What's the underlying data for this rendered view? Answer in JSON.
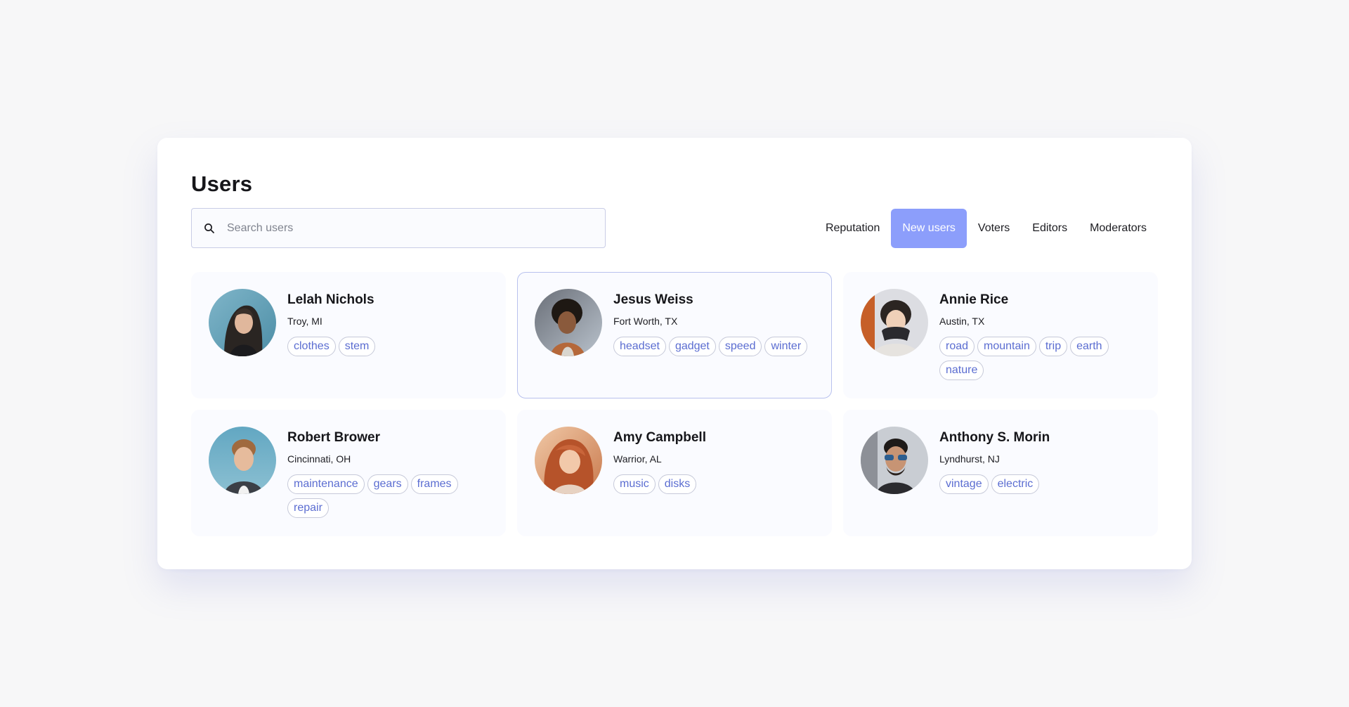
{
  "page": {
    "title": "Users"
  },
  "search": {
    "placeholder": "Search users",
    "value": ""
  },
  "tabs": [
    {
      "label": "Reputation",
      "active": false
    },
    {
      "label": "New users",
      "active": true
    },
    {
      "label": "Voters",
      "active": false
    },
    {
      "label": "Editors",
      "active": false
    },
    {
      "label": "Moderators",
      "active": false
    }
  ],
  "colors": {
    "accent": "#8c9efb",
    "tag_text": "#5b6dd1"
  },
  "users": [
    {
      "name": "Lelah Nichols",
      "location": "Troy, MI",
      "tags": [
        "clothes",
        "stem"
      ],
      "avatar_icon": "avatar-photo"
    },
    {
      "name": "Jesus Weiss",
      "location": "Fort Worth, TX",
      "tags": [
        "headset",
        "gadget",
        "speed",
        "winter"
      ],
      "avatar_icon": "avatar-photo"
    },
    {
      "name": "Annie Rice",
      "location": "Austin, TX",
      "tags": [
        "road",
        "mountain",
        "trip",
        "earth",
        "nature"
      ],
      "avatar_icon": "avatar-photo"
    },
    {
      "name": "Robert Brower",
      "location": "Cincinnati, OH",
      "tags": [
        "maintenance",
        "gears",
        "frames",
        "repair"
      ],
      "avatar_icon": "avatar-photo"
    },
    {
      "name": "Amy Campbell",
      "location": "Warrior, AL",
      "tags": [
        "music",
        "disks"
      ],
      "avatar_icon": "avatar-photo"
    },
    {
      "name": "Anthony S. Morin",
      "location": "Lyndhurst, NJ",
      "tags": [
        "vintage",
        "electric"
      ],
      "avatar_icon": "avatar-photo"
    }
  ]
}
